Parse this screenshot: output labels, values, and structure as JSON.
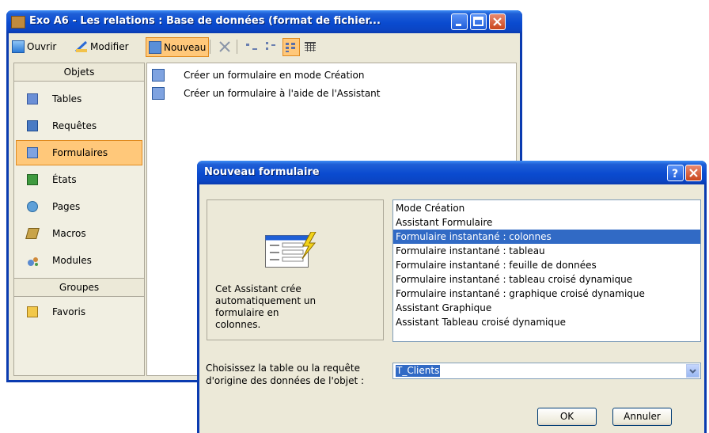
{
  "main_window": {
    "title": "Exo A6 - Les relations : Base de données (format de fichier...",
    "toolbar": {
      "open": "Ouvrir",
      "modify": "Modifier",
      "new": "Nouveau"
    },
    "sidebar": {
      "objects_header": "Objets",
      "items": [
        {
          "label": "Tables",
          "icon": "table-icon"
        },
        {
          "label": "Requêtes",
          "icon": "query-icon"
        },
        {
          "label": "Formulaires",
          "icon": "form-icon"
        },
        {
          "label": "États",
          "icon": "report-icon"
        },
        {
          "label": "Pages",
          "icon": "page-icon"
        },
        {
          "label": "Macros",
          "icon": "macro-icon"
        },
        {
          "label": "Modules",
          "icon": "module-icon"
        }
      ],
      "groups_header": "Groupes",
      "favorites": "Favoris"
    },
    "list": [
      "Créer un formulaire en mode Création",
      "Créer un formulaire à l'aide de l'Assistant"
    ]
  },
  "dialog": {
    "title": "Nouveau formulaire",
    "description": "Cet Assistant crée automatiquement un formulaire en colonnes.",
    "options": [
      "Mode Création",
      "Assistant Formulaire",
      "Formulaire instantané : colonnes",
      "Formulaire instantané : tableau",
      "Formulaire instantané : feuille de données",
      "Formulaire instantané : tableau croisé dynamique",
      "Formulaire instantané : graphique croisé dynamique",
      "Assistant Graphique",
      "Assistant Tableau croisé dynamique"
    ],
    "selected_option": "Formulaire instantané : colonnes",
    "source_label": "Choisissez la table ou la requête d'origine des données de l'objet :",
    "source_value": "T_Clients",
    "ok": "OK",
    "cancel": "Annuler"
  }
}
